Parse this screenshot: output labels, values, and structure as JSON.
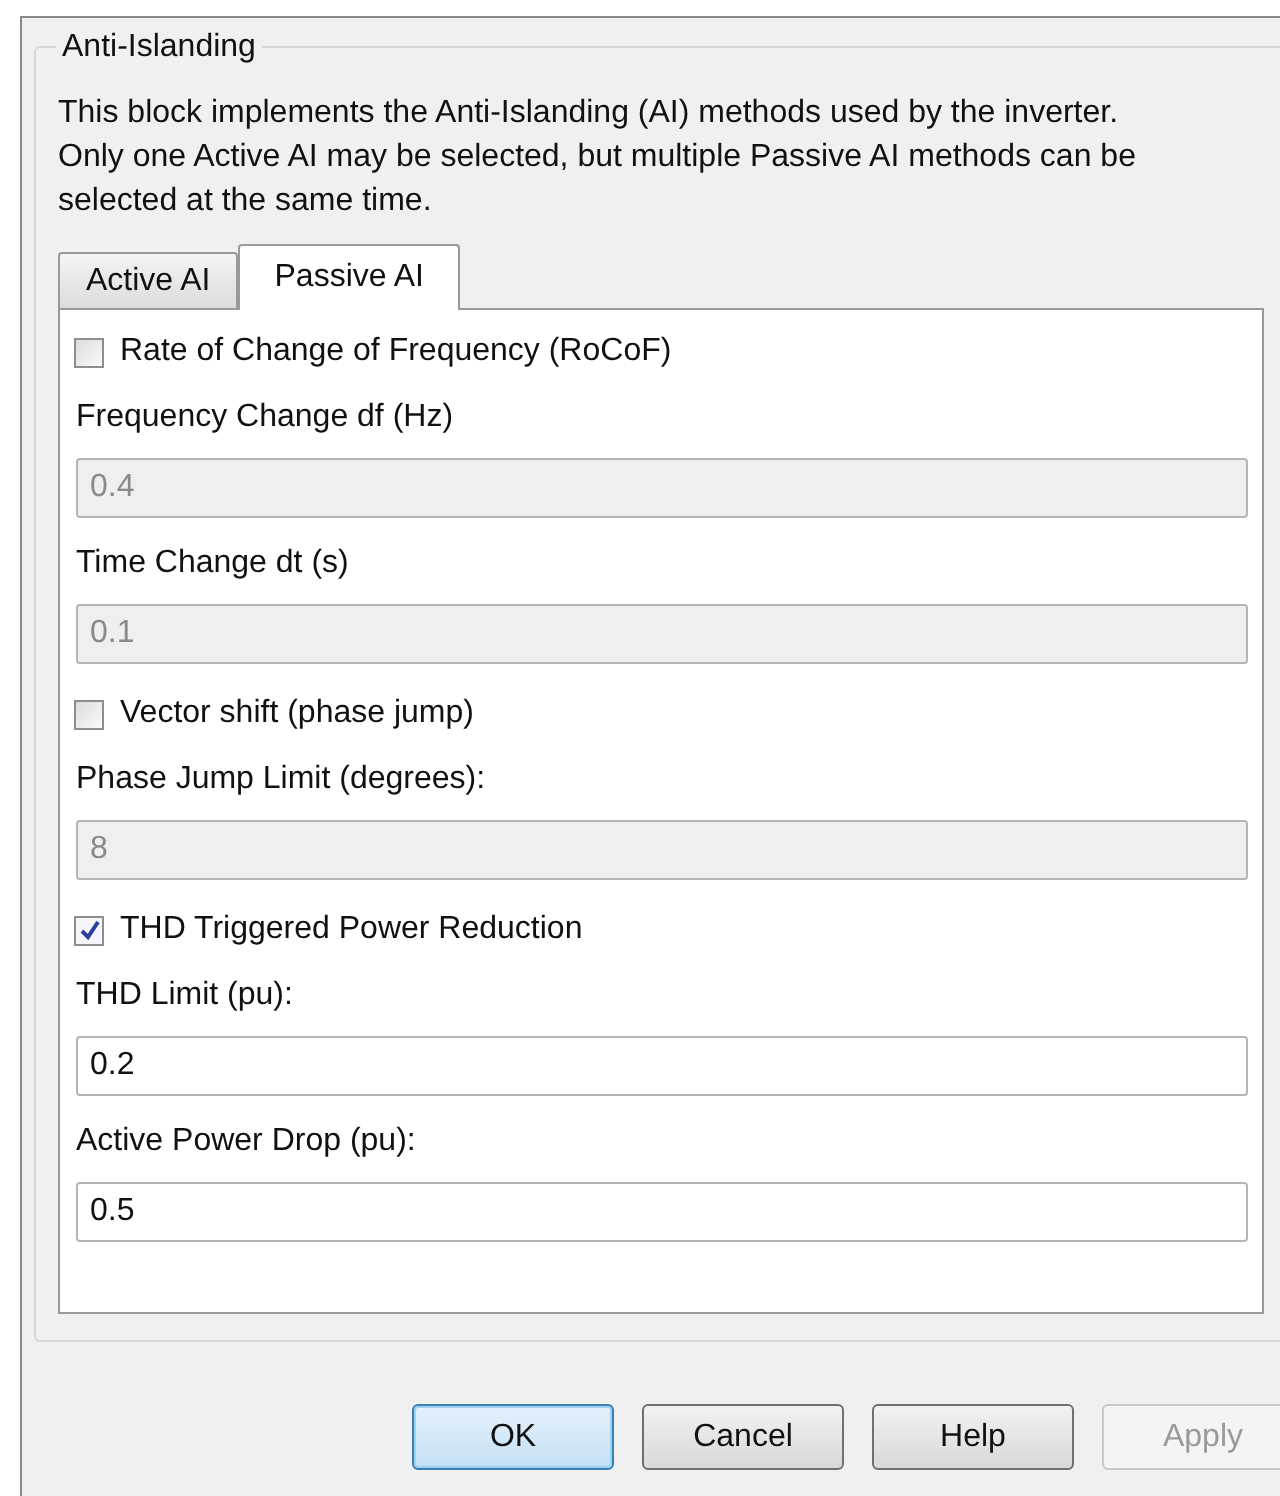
{
  "group": {
    "title": "Anti-Islanding",
    "description": "This block implements the Anti-Islanding (AI) methods used by the inverter. Only one Active AI may be selected, but multiple Passive AI methods can be selected at the same time."
  },
  "tabs": [
    {
      "label": "Active AI",
      "selected": false
    },
    {
      "label": "Passive AI",
      "selected": true
    }
  ],
  "items": [
    {
      "kind": "checkbox",
      "label": "Rate of Change of Frequency (RoCoF)",
      "checked": false
    },
    {
      "kind": "field",
      "label": "Frequency Change df (Hz)",
      "value": "0.4",
      "disabled": true
    },
    {
      "kind": "field",
      "label": "Time Change dt (s)",
      "value": "0.1",
      "disabled": true
    },
    {
      "kind": "checkbox",
      "label": "Vector shift (phase jump)",
      "checked": false
    },
    {
      "kind": "field",
      "label": "Phase Jump Limit (degrees):",
      "value": "8",
      "disabled": true
    },
    {
      "kind": "checkbox",
      "label": "THD Triggered Power Reduction",
      "checked": true
    },
    {
      "kind": "field",
      "label": "THD Limit (pu):",
      "value": "0.2",
      "disabled": false
    },
    {
      "kind": "field",
      "label": "Active Power Drop (pu):",
      "value": "0.5",
      "disabled": false
    }
  ],
  "buttons": [
    {
      "label": "OK",
      "default": true,
      "disabled": false
    },
    {
      "label": "Cancel",
      "default": false,
      "disabled": false
    },
    {
      "label": "Help",
      "default": false,
      "disabled": false
    },
    {
      "label": "Apply",
      "default": false,
      "disabled": true
    }
  ]
}
